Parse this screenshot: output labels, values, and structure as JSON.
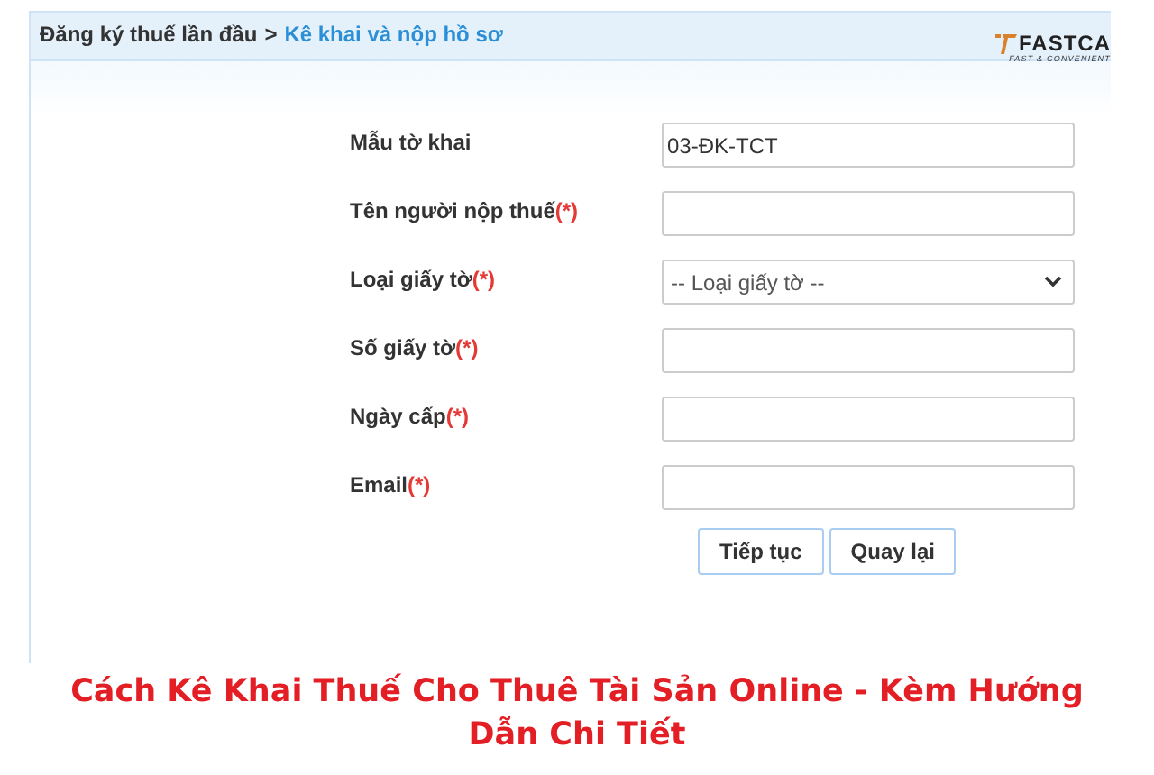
{
  "breadcrumb": {
    "parent": "Đăng ký thuế lần đầu",
    "separator": ">",
    "current": "Kê khai và nộp hồ sơ"
  },
  "logo": {
    "name": "FASTCA",
    "tagline": "FAST & CONVENIENT"
  },
  "fields": [
    {
      "label": "Mẫu tờ khai",
      "required": false,
      "kind": "text",
      "value": "03-ĐK-TCT"
    },
    {
      "label": "Tên người nộp thuế",
      "required": true,
      "kind": "text"
    },
    {
      "label": "Loại giấy tờ",
      "required": true,
      "kind": "select",
      "value": "-- Loại giấy tờ --"
    },
    {
      "label": "Số giấy tờ",
      "required": true,
      "kind": "text"
    },
    {
      "label": "Ngày cấp",
      "required": true,
      "kind": "text"
    },
    {
      "label": "Email",
      "required": true,
      "kind": "text"
    }
  ],
  "required_mark": "(*)",
  "buttons": [
    "Tiếp tục",
    "Quay lại"
  ],
  "caption": "Cách Kê Khai Thuế Cho Thuê Tài Sản Online - Kèm Hướng Dẫn Chi Tiết"
}
